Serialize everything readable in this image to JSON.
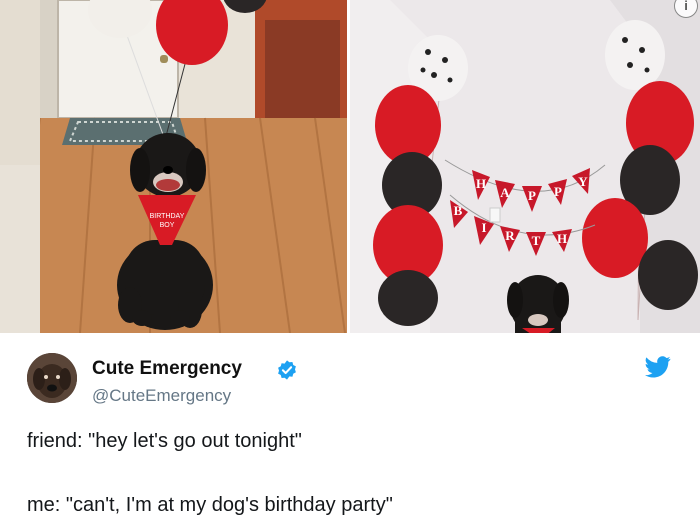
{
  "photos": {
    "left_alt": "Black dog in red birthday bandana with balloons",
    "right_alt": "Dog at birthday party with balloons and Happy Birthday banner",
    "banner_letters": [
      "H",
      "A",
      "P",
      "P",
      "Y",
      "B",
      "I",
      "R",
      "T",
      "H"
    ]
  },
  "tweet": {
    "display_name": "Cute Emergency",
    "handle": "@CuteEmergency",
    "verified": true,
    "lines": [
      "friend: \"hey let's go out tonight\"",
      "me: \"can't, I'm at my dog's birthday party\""
    ]
  },
  "colors": {
    "brand_blue": "#1da1f2",
    "balloon_red": "#d4141f",
    "balloon_black": "#2a2626",
    "handle_gray": "#657786"
  },
  "icons": {
    "info": "info-icon",
    "verified": "verified-badge-icon",
    "twitter": "twitter-bird-icon"
  }
}
